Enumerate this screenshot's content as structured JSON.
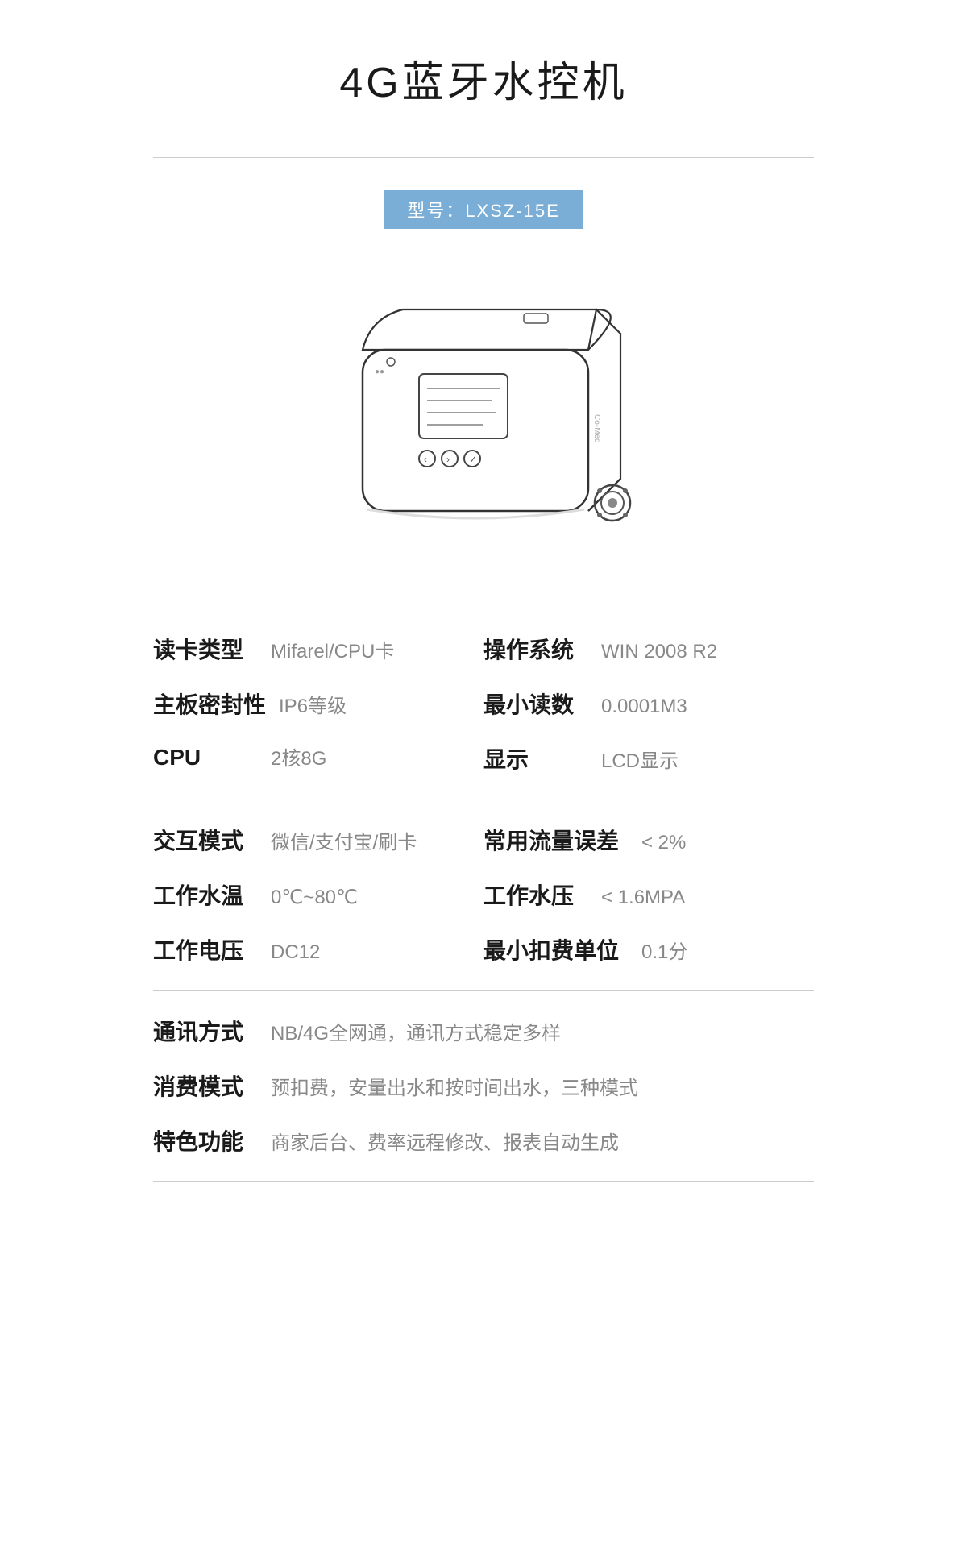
{
  "page": {
    "title": "4G蓝牙水控机"
  },
  "model": {
    "label": "型号：LXSZ-15E"
  },
  "specs_group1": {
    "rows": [
      {
        "left_label": "读卡类型",
        "left_value": "Mifarel/CPU卡",
        "right_label": "操作系统",
        "right_value": "WIN 2008 R2"
      },
      {
        "left_label": "主板密封性",
        "left_value": "IP6等级",
        "right_label": "最小读数",
        "right_value": "0.0001M3"
      },
      {
        "left_label": "CPU",
        "left_value": "2核8G",
        "right_label": "显示",
        "right_value": "LCD显示"
      }
    ]
  },
  "specs_group2": {
    "rows": [
      {
        "left_label": "交互模式",
        "left_value": "微信/支付宝/刷卡",
        "right_label": "常用流量误差",
        "right_value": "< 2%"
      },
      {
        "left_label": "工作水温",
        "left_value": "0℃~80℃",
        "right_label": "工作水压",
        "right_value": "< 1.6MPA"
      },
      {
        "left_label": "工作电压",
        "left_value": "DC12",
        "right_label": "最小扣费单位",
        "right_value": "0.1分"
      }
    ]
  },
  "specs_group3": {
    "rows": [
      {
        "label": "通讯方式",
        "value": "NB/4G全网通，通讯方式稳定多样"
      },
      {
        "label": "消费模式",
        "value": "预扣费，安量出水和按时间出水，三种模式"
      },
      {
        "label": "特色功能",
        "value": "商家后台、费率远程修改、报表自动生成"
      }
    ]
  }
}
